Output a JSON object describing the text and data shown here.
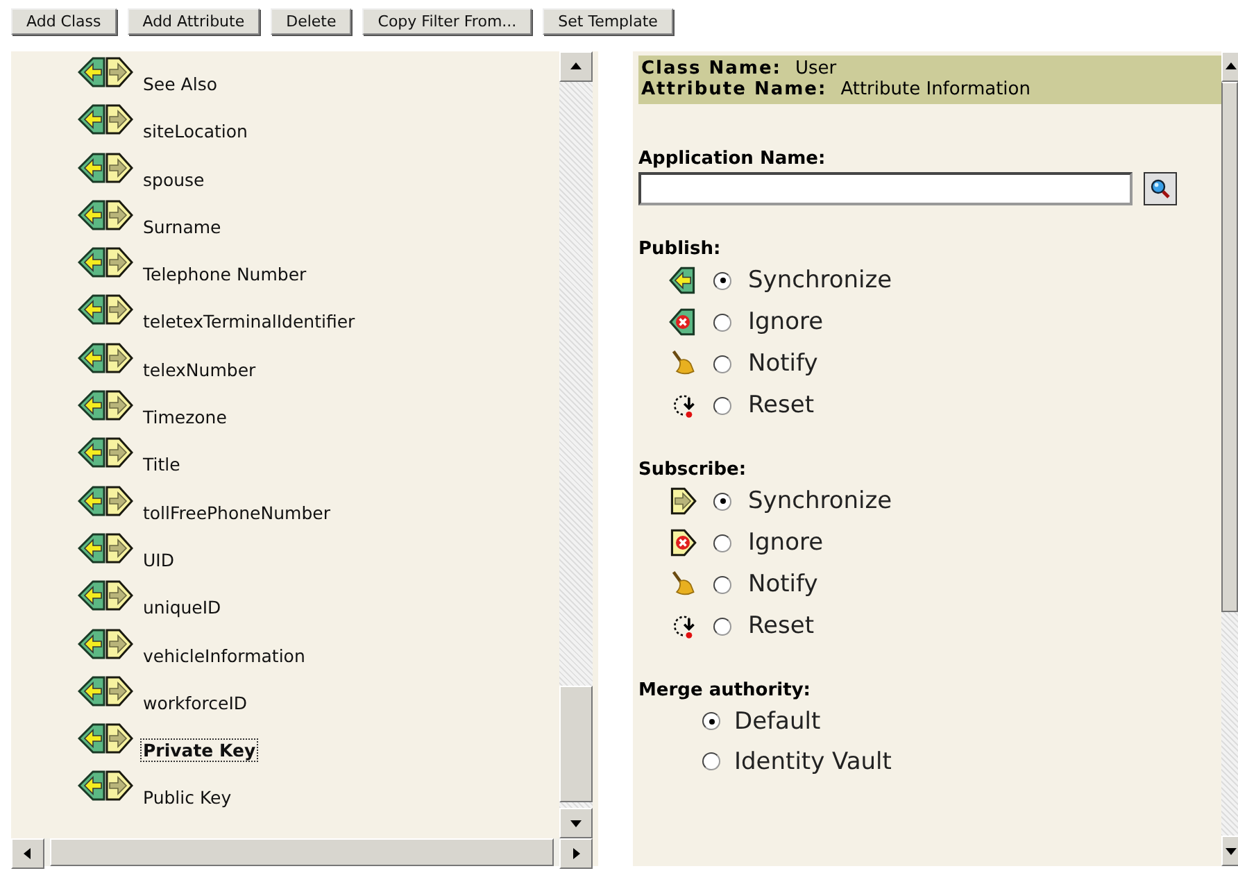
{
  "toolbar": [
    "Add Class",
    "Add Attribute",
    "Delete",
    "Copy Filter From...",
    "Set Template"
  ],
  "attributes": [
    {
      "label": "See Also",
      "selected": false
    },
    {
      "label": "siteLocation",
      "selected": false
    },
    {
      "label": "spouse",
      "selected": false
    },
    {
      "label": "Surname",
      "selected": false
    },
    {
      "label": "Telephone Number",
      "selected": false
    },
    {
      "label": "teletexTerminalIdentifier",
      "selected": false
    },
    {
      "label": "telexNumber",
      "selected": false
    },
    {
      "label": "Timezone",
      "selected": false
    },
    {
      "label": "Title",
      "selected": false
    },
    {
      "label": "tollFreePhoneNumber",
      "selected": false
    },
    {
      "label": "UID",
      "selected": false
    },
    {
      "label": "uniqueID",
      "selected": false
    },
    {
      "label": "vehicleInformation",
      "selected": false
    },
    {
      "label": "workforceID",
      "selected": false
    },
    {
      "label": "Private Key",
      "selected": true
    },
    {
      "label": "Public Key",
      "selected": false
    }
  ],
  "header": {
    "class_label": "Class Name:",
    "class_value": "User",
    "attribute_label": "Attribute Name:",
    "attribute_value": "Attribute Information"
  },
  "application": {
    "label": "Application Name:"
  },
  "sections": [
    {
      "kind": "publish",
      "title": "Publish:",
      "options": [
        {
          "kind": "synchronize",
          "label": "Synchronize",
          "selected": true
        },
        {
          "kind": "ignore",
          "label": "Ignore",
          "selected": false
        },
        {
          "kind": "notify",
          "label": "Notify",
          "selected": false
        },
        {
          "kind": "reset",
          "label": "Reset",
          "selected": false
        }
      ]
    },
    {
      "kind": "subscribe",
      "title": "Subscribe:",
      "options": [
        {
          "kind": "synchronize",
          "label": "Synchronize",
          "selected": true
        },
        {
          "kind": "ignore",
          "label": "Ignore",
          "selected": false
        },
        {
          "kind": "notify",
          "label": "Notify",
          "selected": false
        },
        {
          "kind": "reset",
          "label": "Reset",
          "selected": false
        }
      ]
    }
  ],
  "merge": {
    "title": "Merge authority:",
    "options": [
      {
        "label": "Default",
        "selected": true
      },
      {
        "label": "Identity Vault",
        "selected": false
      }
    ]
  }
}
